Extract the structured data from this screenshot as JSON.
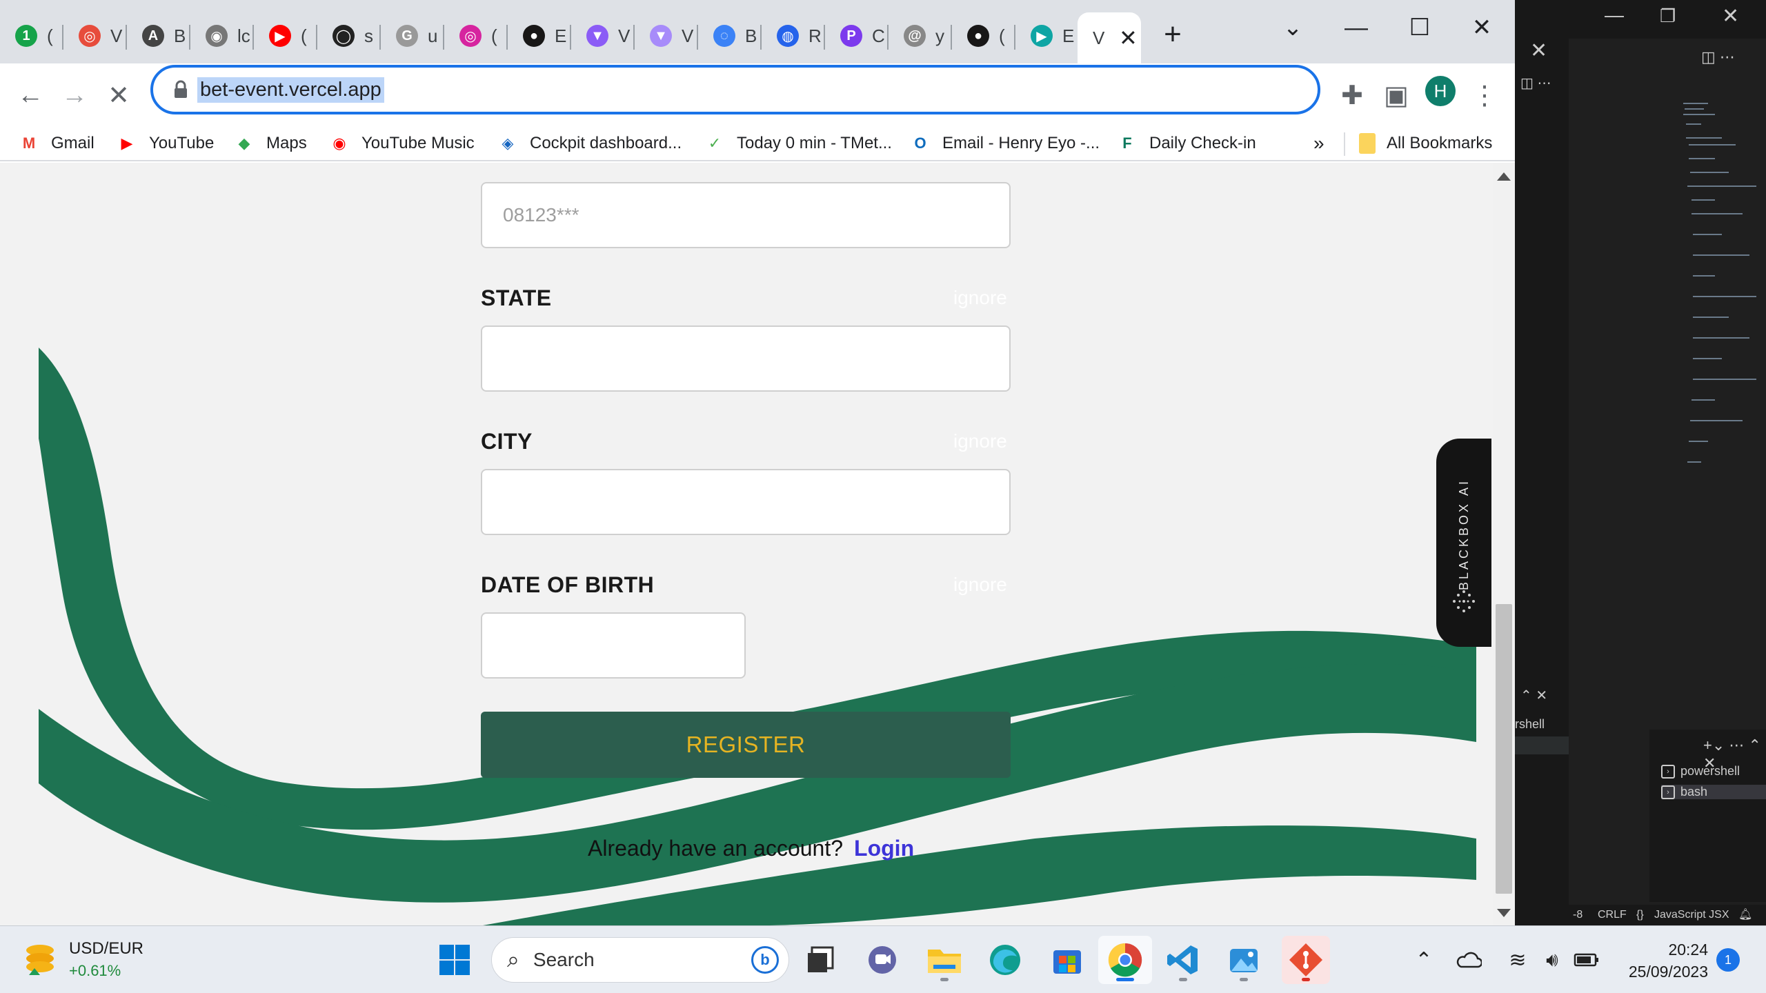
{
  "browser": {
    "tabs": [
      {
        "label": "(",
        "fav": "1",
        "color": "#16a34a"
      },
      {
        "label": "V",
        "fav": "◎",
        "color": "#e74c3c"
      },
      {
        "label": "B",
        "fav": "A",
        "color": "#444444"
      },
      {
        "label": "lc",
        "fav": "◉",
        "color": "#777777"
      },
      {
        "label": "(",
        "fav": "▶",
        "color": "#ff0000"
      },
      {
        "label": "s",
        "fav": "◯",
        "color": "#222222"
      },
      {
        "label": "u",
        "fav": "G",
        "color": "#999999"
      },
      {
        "label": "(",
        "fav": "◎",
        "color": "#d6249f"
      },
      {
        "label": "E",
        "fav": "●",
        "color": "#181717"
      },
      {
        "label": "V",
        "fav": "▼",
        "color": "#8b5cf6"
      },
      {
        "label": "V",
        "fav": "▼",
        "color": "#a78bfa"
      },
      {
        "label": "B",
        "fav": "◌",
        "color": "#3b82f6"
      },
      {
        "label": "R",
        "fav": "◍",
        "color": "#2563eb"
      },
      {
        "label": "C",
        "fav": "P",
        "color": "#7c3aed"
      },
      {
        "label": "y",
        "fav": "@",
        "color": "#888888"
      },
      {
        "label": "(",
        "fav": "●",
        "color": "#181717"
      },
      {
        "label": "E",
        "fav": "▶",
        "color": "#0ea5a4"
      }
    ],
    "active_tab": {
      "label": "V"
    },
    "new_tab": "+",
    "url": "bet-event.vercel.app",
    "profile_initial": "H",
    "bookmarks": [
      {
        "label": "Gmail",
        "icon": "M",
        "color": "#ea4335"
      },
      {
        "label": "YouTube",
        "icon": "▶",
        "color": "#ff0000"
      },
      {
        "label": "Maps",
        "icon": "◆",
        "color": "#34a853"
      },
      {
        "label": "YouTube Music",
        "icon": "◉",
        "color": "#ff0000"
      },
      {
        "label": "Cockpit dashboard...",
        "icon": "◈",
        "color": "#1565c0"
      },
      {
        "label": "Today 0 min - TMet...",
        "icon": "✓",
        "color": "#4caf50"
      },
      {
        "label": "Email - Henry Eyo -...",
        "icon": "O",
        "color": "#0f6cbd"
      },
      {
        "label": "Daily Check-in",
        "icon": "F",
        "color": "#0e7a5f"
      }
    ],
    "bookmarks_overflow": "»",
    "all_bookmarks": "All Bookmarks"
  },
  "form": {
    "phone_placeholder": "08123***",
    "fields": [
      {
        "label": "STATE",
        "hint": "ignore"
      },
      {
        "label": "CITY",
        "hint": "ignore"
      },
      {
        "label": "DATE OF BIRTH",
        "hint": "ignore"
      }
    ],
    "register": "REGISTER",
    "already_text": "Already have an account?",
    "login": "Login"
  },
  "extension_tab": "BLACKBOX AI",
  "theme": {
    "wave": "#1e7352",
    "button": "#2c5e4e",
    "button_text": "#e6b422",
    "link": "#3d34d8"
  },
  "vscode": {
    "terminal_label": "rshell",
    "terminals": [
      "powershell",
      "bash"
    ],
    "status": {
      "encoding_suffix": "-8",
      "eol": "CRLF",
      "language": "JavaScript JSX"
    }
  },
  "taskbar": {
    "widget_title": "USD/EUR",
    "widget_value": "+0.61%",
    "search_placeholder": "Search",
    "time": "20:24",
    "date": "25/09/2023",
    "notifications": "1"
  }
}
